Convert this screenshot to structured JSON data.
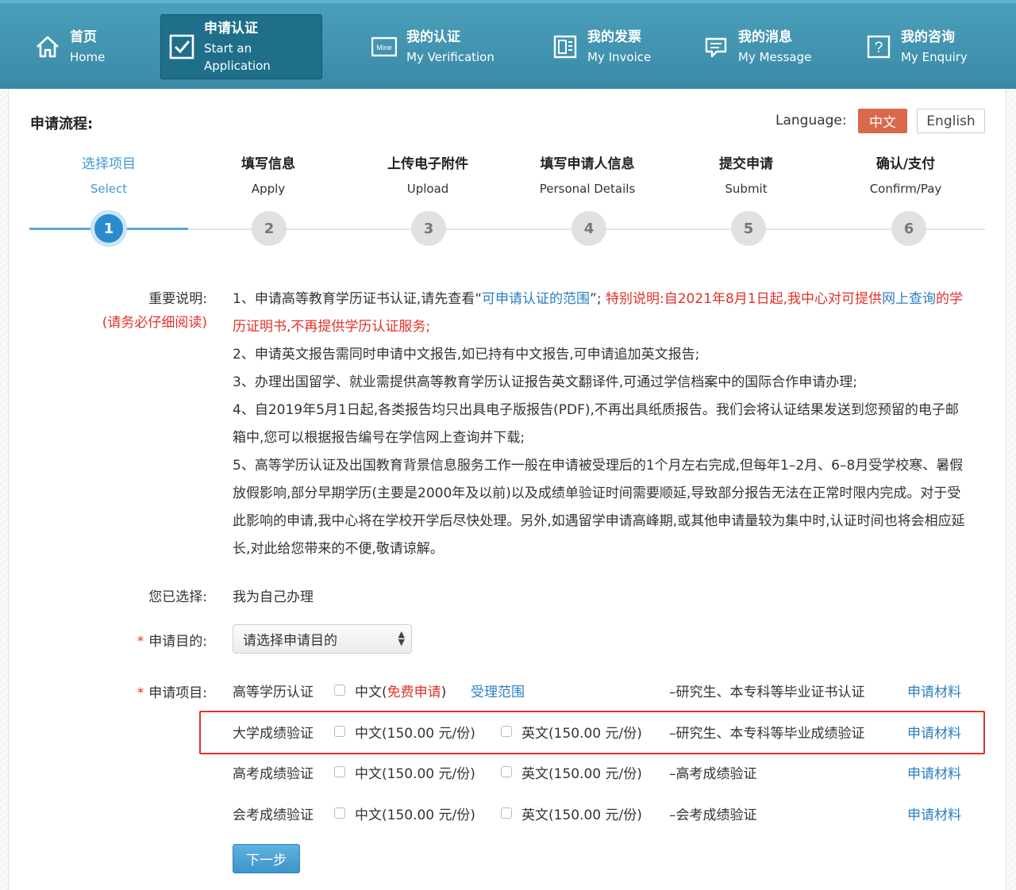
{
  "nav": {
    "items": [
      {
        "cn": "首页",
        "en": "Home",
        "icon": "home-icon"
      },
      {
        "cn": "申请认证",
        "en": "Start an Application",
        "icon": "checkbox-icon"
      },
      {
        "cn": "我的认证",
        "en": "My Verification",
        "icon": "mine-icon"
      },
      {
        "cn": "我的发票",
        "en": "My Invoice",
        "icon": "invoice-icon"
      },
      {
        "cn": "我的消息",
        "en": "My Message",
        "icon": "message-icon"
      },
      {
        "cn": "我的咨询",
        "en": "My Enquiry",
        "icon": "question-icon"
      }
    ],
    "mine_icon_text": "Mine",
    "question_icon_text": "?"
  },
  "process_title": "申请流程:",
  "language": {
    "label": "Language:",
    "cn": "中文",
    "en": "English"
  },
  "steps": [
    {
      "cn": "选择项目",
      "en": "Select",
      "num": "1"
    },
    {
      "cn": "填写信息",
      "en": "Apply",
      "num": "2"
    },
    {
      "cn": "上传电子附件",
      "en": "Upload",
      "num": "3"
    },
    {
      "cn": "填写申请人信息",
      "en": "Personal Details",
      "num": "4"
    },
    {
      "cn": "提交申请",
      "en": "Submit",
      "num": "5"
    },
    {
      "cn": "确认/支付",
      "en": "Confirm/Pay",
      "num": "6"
    }
  ],
  "notes": {
    "label": "重要说明:",
    "label_sub": "(请务必仔细阅读)",
    "n1_a": "1、申请高等教育学历证书认证,请先查看“",
    "n1_link": "可申请认证的范围",
    "n1_b": "”; ",
    "n1_special": "特别说明:自2021年8月1日起,我中心对可提供",
    "n1_link2": "网上查询",
    "n1_special2": "的学历证明书,不再提供学历认证服务;",
    "n2": "2、申请英文报告需同时申请中文报告,如已持有中文报告,可申请追加英文报告;",
    "n3": "3、办理出国留学、就业需提供高等教育学历认证报告英文翻译件,可通过学信档案中的国际合作申请办理;",
    "n4": "4、自2019年5月1日起,各类报告均只出具电子版报告(PDF),不再出具纸质报告。我们会将认证结果发送到您预留的电子邮箱中,您可以根据报告编号在学信网上查询并下载;",
    "n5": "5、高等学历认证及出国教育背景信息服务工作一般在申请被受理后的1个月左右完成,但每年1–2月、6–8月受学校寒、暑假放假影响,部分早期学历(主要是2000年及以前)以及成绩单验证时间需要顺延,导致部分报告无法在正常时限内完成。对于受此影响的申请,我中心将在学校开学后尽快处理。另外,如遇留学申请高峰期,或其他申请量较为集中时,认证时间也将会相应延长,对此给您带来的不便,敬请谅解。"
  },
  "selected": {
    "label": "您已选择:",
    "value": "我为自己办理"
  },
  "purpose": {
    "star": "*",
    "label": "申请目的:",
    "placeholder": "请选择申请目的"
  },
  "projects": {
    "star": "*",
    "label": "申请项目:",
    "rows": [
      {
        "name": "高等学历认证",
        "cn_opt": "中文(",
        "cn_free": "免费申请",
        "cn_close": ")",
        "scope": "受理范围",
        "en_opt": "",
        "desc": "–研究生、本专科等毕业证书认证",
        "material": "申请材料"
      },
      {
        "name": "大学成绩验证",
        "cn_opt": "中文(150.00 元/份)",
        "en_opt": "英文(150.00 元/份)",
        "desc": "–研究生、本专科等毕业成绩验证",
        "material": "申请材料"
      },
      {
        "name": "高考成绩验证",
        "cn_opt": "中文(150.00 元/份)",
        "en_opt": "英文(150.00 元/份)",
        "desc": "–高考成绩验证",
        "material": "申请材料"
      },
      {
        "name": "会考成绩验证",
        "cn_opt": "中文(150.00 元/份)",
        "en_opt": "英文(150.00 元/份)",
        "desc": "–会考成绩验证",
        "material": "申请材料"
      }
    ]
  },
  "next_button": "下一步",
  "colors": {
    "nav": "#3a8aa6",
    "active_step": "#2a8ccf",
    "accent_red": "#e0322a",
    "link": "#2a7fc2",
    "lang_cn": "#d9684c"
  }
}
